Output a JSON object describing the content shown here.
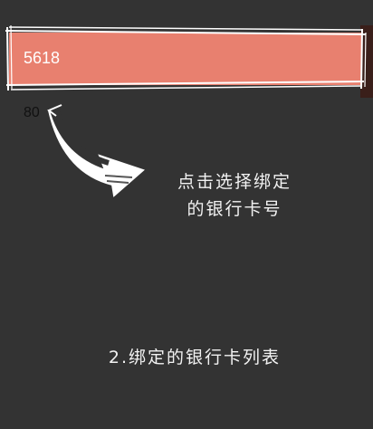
{
  "card": {
    "number": "5618",
    "peek_number": "80"
  },
  "annotations": {
    "select_line1": "点击选择绑定",
    "select_line2": "的银行卡号",
    "list_label": "2.绑定的银行卡列表"
  },
  "icons": {
    "arrow": "hand-drawn-curved-arrow-icon"
  },
  "colors": {
    "background": "#333333",
    "card": "#e8806f",
    "sketch": "#ffffff"
  }
}
